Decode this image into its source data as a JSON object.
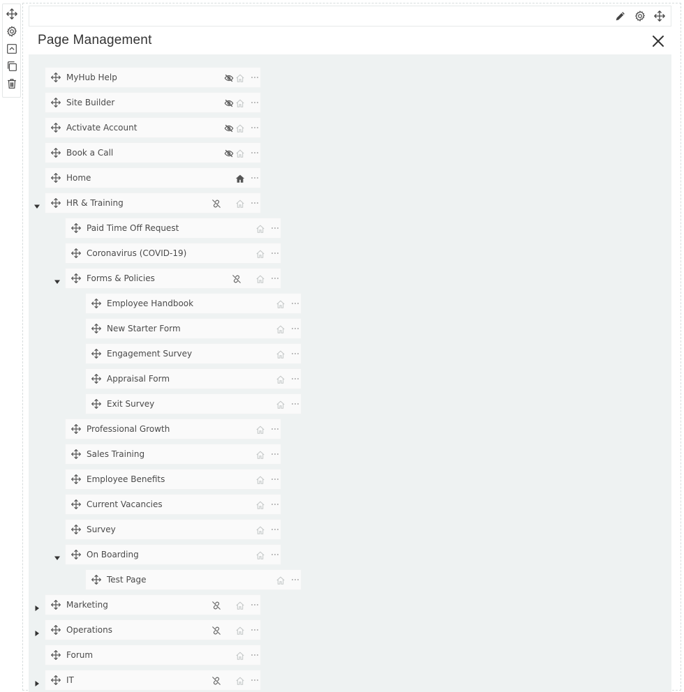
{
  "header": {
    "title": "Page Management"
  },
  "icons": {
    "move": "move-icon",
    "settings": "gear-icon",
    "collapse": "collapse-icon",
    "duplicate": "copy-icon",
    "delete": "trash-icon",
    "edit": "pencil-icon",
    "close": "close-icon",
    "hidden": "eye-slash-icon",
    "unlinked": "unlink-icon",
    "home": "home-icon",
    "more": "more-icon"
  },
  "colors": {
    "panel": "#eef2f2",
    "row": "#fafafa",
    "icon": "#555555",
    "faint": "#c4c8c8"
  },
  "pages": [
    {
      "label": "MyHub Help",
      "level": 0
    },
    {
      "label": "Site Builder",
      "level": 0
    },
    {
      "label": "Activate Account",
      "level": 0
    },
    {
      "label": "Book a Call",
      "level": 0
    },
    {
      "label": "Home",
      "level": 0
    },
    {
      "label": "HR & Training",
      "level": 0
    },
    {
      "label": "Paid Time Off Request",
      "level": 1
    },
    {
      "label": "Coronavirus (COVID-19)",
      "level": 1
    },
    {
      "label": "Forms & Policies",
      "level": 1
    },
    {
      "label": "Employee Handbook",
      "level": 2
    },
    {
      "label": "New Starter Form",
      "level": 2
    },
    {
      "label": "Engagement Survey",
      "level": 2
    },
    {
      "label": "Appraisal Form",
      "level": 2
    },
    {
      "label": "Exit Survey",
      "level": 2
    },
    {
      "label": "Professional Growth",
      "level": 1
    },
    {
      "label": "Sales Training",
      "level": 1
    },
    {
      "label": "Employee Benefits",
      "level": 1
    },
    {
      "label": "Current Vacancies",
      "level": 1
    },
    {
      "label": "Survey",
      "level": 1
    },
    {
      "label": "On Boarding",
      "level": 1
    },
    {
      "label": "Test Page",
      "level": 2
    },
    {
      "label": "Marketing",
      "level": 0
    },
    {
      "label": "Operations",
      "level": 0
    },
    {
      "label": "Forum",
      "level": 0
    },
    {
      "label": "IT",
      "level": 0
    }
  ]
}
